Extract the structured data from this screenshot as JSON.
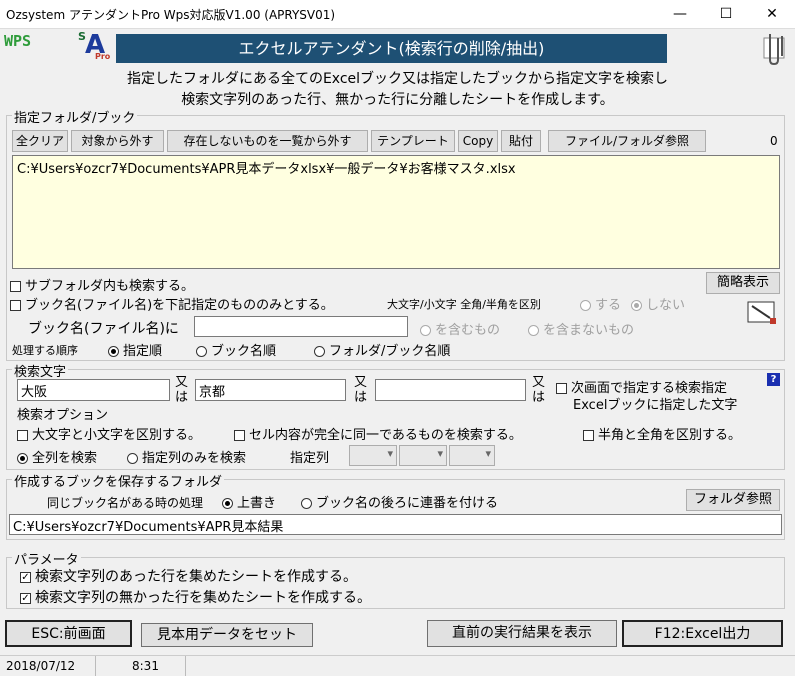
{
  "window": {
    "title": "Ozsystem アテンダントPro Wps対応版V1.00 (APRYSV01)",
    "minimize": "—",
    "maximize": "☐",
    "close": "✕"
  },
  "header": {
    "wps_logo": "WPS",
    "app_logo_s": "S",
    "app_logo_a": "A",
    "app_logo_pro": "Pro",
    "banner": "エクセルアテンダント(検索行の削除/抽出)",
    "desc1": "指定したフォルダにある全てのExcelブック又は指定したブックから指定文字を検索し",
    "desc2": "検索文字列のあった行、無かった行に分離したシートを作成します。"
  },
  "folder_section": {
    "label": "指定フォルダ/ブック",
    "buttons": [
      "全クリア",
      "対象から外す",
      "存在しないものを一覧から外す",
      "テンプレート",
      "Copy",
      "貼付",
      "ファイル/フォルダ参照"
    ],
    "count": "0",
    "list_item": "C:¥Users¥ozcr7¥Documents¥APR見本データxlsx¥一般データ¥お客様マスタ.xlsx",
    "subfolder_label": "サブフォルダ内も検索する。",
    "bookname_only_label": "ブック名(ファイル名)を下記指定のもののみとする。",
    "case_label": "大文字/小文字 全角/半角を区別",
    "case_yes": "する",
    "case_no": "しない",
    "summary_button": "簡略表示",
    "bookname_prefix": "ブック名(ファイル名)に",
    "contains": "を含むもの",
    "not_contains": "を含まないもの",
    "order_label": "処理する順序",
    "order_options": [
      "指定順",
      "ブック名順",
      "フォルダ/ブック名順"
    ]
  },
  "search_section": {
    "label": "検索文字",
    "term1": "大阪",
    "or1": "又は",
    "term2": "京都",
    "or2": "又は",
    "term3": "",
    "or3": "又は",
    "next_screen_label": "次画面で指定する検索指定",
    "next_screen_label2": "Excelブックに指定した文字",
    "help": "?",
    "options_label": "検索オプション",
    "opt_case": "大文字と小文字を区別する。",
    "opt_exact": "セル内容が完全に同一であるものを検索する。",
    "opt_width": "半角と全角を区別する。",
    "all_columns": "全列を検索",
    "specified_columns": "指定列のみを検索",
    "column_label": "指定列"
  },
  "save_section": {
    "label": "作成するブックを保存するフォルダ",
    "same_name_label": "同じブック名がある時の処理",
    "overwrite": "上書き",
    "append_number": "ブック名の後ろに連番を付ける",
    "folder_button": "フォルダ参照",
    "path": "C:¥Users¥ozcr7¥Documents¥APR見本結果"
  },
  "param_section": {
    "label": "パラメータ",
    "opt1": "検索文字列のあった行を集めたシートを作成する。",
    "opt2": "検索文字列の無かった行を集めたシートを作成する。"
  },
  "footer": {
    "esc": "ESC:前画面",
    "sample": "見本用データをセット",
    "show_last": "直前の実行結果を表示",
    "f12": "F12:Excel出力",
    "date": "2018/07/12",
    "time": "8:31"
  }
}
